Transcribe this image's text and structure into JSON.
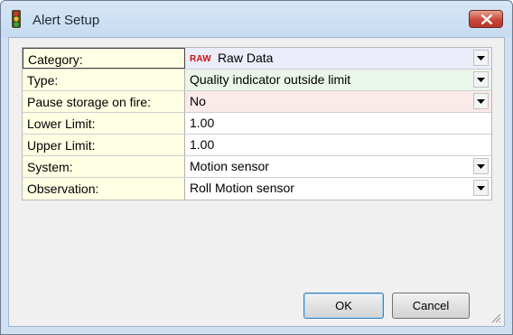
{
  "window": {
    "title": "Alert Setup",
    "icon": "traffic-light-icon",
    "close_icon": "close-icon"
  },
  "form": {
    "rows": [
      {
        "label": "Category:",
        "value": "Raw Data",
        "badge": "RAW",
        "control": "dropdown"
      },
      {
        "label": "Type:",
        "value": "Quality indicator outside limit",
        "control": "dropdown"
      },
      {
        "label": "Pause storage on fire:",
        "value": "No",
        "control": "dropdown"
      },
      {
        "label": "Lower Limit:",
        "value": "1.00",
        "control": "text"
      },
      {
        "label": "Upper Limit:",
        "value": "1.00",
        "control": "text"
      },
      {
        "label": "System:",
        "value": "Motion sensor",
        "control": "dropdown"
      },
      {
        "label": "Observation:",
        "value": "Roll Motion sensor",
        "control": "dropdown"
      }
    ]
  },
  "buttons": {
    "ok_label": "OK",
    "cancel_label": "Cancel"
  },
  "colors": {
    "label_bg": "#ffffe4",
    "category_bg": "#ecedfb",
    "type_bg": "#ebf6eb",
    "pause_bg": "#fbeaea",
    "badge_red": "#cc1111",
    "close_red": "#c9483a"
  }
}
